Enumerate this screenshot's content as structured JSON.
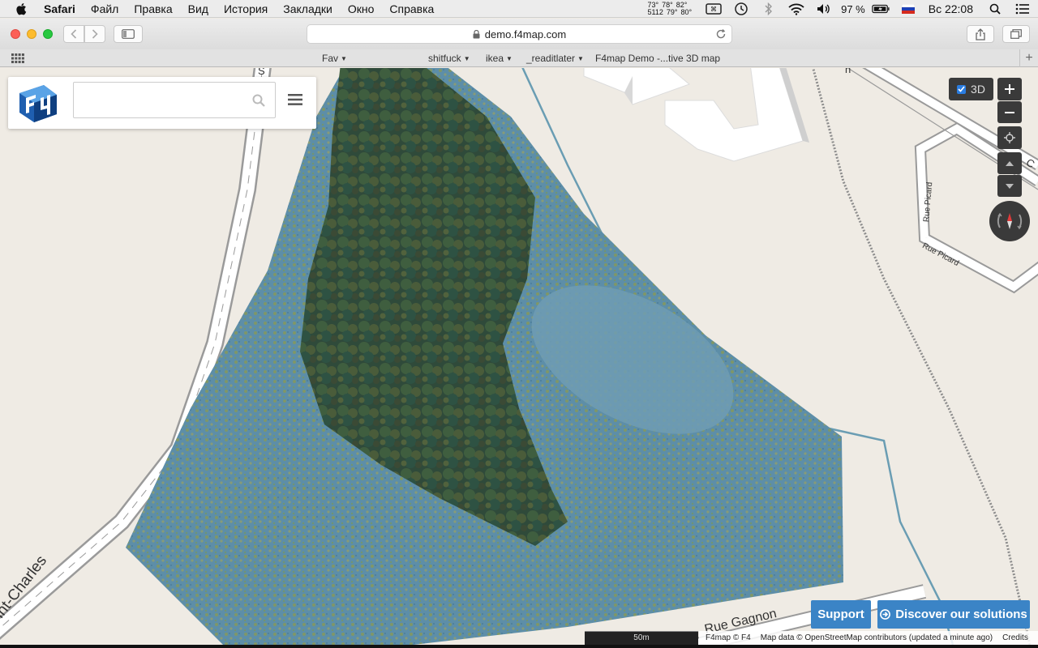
{
  "menubar": {
    "app_name": "Safari",
    "items": [
      "Файл",
      "Правка",
      "Вид",
      "История",
      "Закладки",
      "Окно",
      "Справка"
    ],
    "temps_row1": [
      "73°",
      "78°",
      "82°"
    ],
    "temps_row2": [
      "5112",
      "79°",
      "80°"
    ],
    "battery_percent": "97 %",
    "clock": "Вс 22:08"
  },
  "toolbar": {
    "url": "demo.f4map.com"
  },
  "bookmarks": {
    "items": [
      "Fav",
      "shitfuck",
      "ikea",
      "_readitlater",
      "F4map Demo -...tive 3D map"
    ]
  },
  "search": {
    "value": "",
    "placeholder": ""
  },
  "controls": {
    "toggle_3d_label": "3D",
    "toggle_3d_checked": true
  },
  "map_labels": {
    "street_saint_charles": "int-Charles",
    "street_gagnon": "Rue Gagnon",
    "street_picard_1": "Rue Picard",
    "street_picard_2": "Rue Picard",
    "street_top_s": "S",
    "street_top_n": "n",
    "street_top_c": "C"
  },
  "footer": {
    "support_label": "Support",
    "discover_label": "Discover our solutions",
    "scale_label": "50m",
    "attrib_f4": "F4map © F4",
    "attrib_osm": "Map data © OpenStreetMap contributors (updated a minute ago)",
    "attrib_credits": "Credits"
  },
  "colors": {
    "accent_blue": "#3b84c6",
    "control_dark": "#3a3a3a",
    "wetland": "#5f8fa8",
    "land": "#efebe4"
  }
}
